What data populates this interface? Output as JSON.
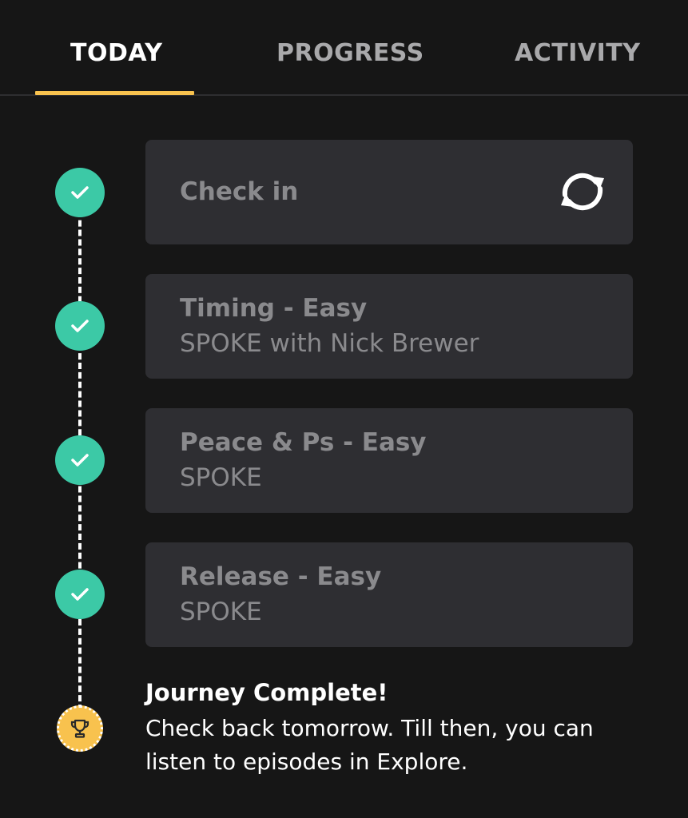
{
  "tabs": [
    {
      "label": "TODAY",
      "active": true
    },
    {
      "label": "PROGRESS",
      "active": false
    },
    {
      "label": "ACTIVITY",
      "active": false
    }
  ],
  "colors": {
    "background": "#161616",
    "accent": "#f8c24e",
    "check": "#3cc9a6",
    "card": "#2e2e32",
    "muted_text": "#8a8a8d"
  },
  "steps": [
    {
      "title": "Check in",
      "subtitle": "",
      "icon": "sync-icon",
      "completed": true
    },
    {
      "title": "Timing - Easy",
      "subtitle": "SPOKE with Nick Brewer",
      "completed": true
    },
    {
      "title": "Peace & Ps - Easy",
      "subtitle": "SPOKE",
      "completed": true
    },
    {
      "title": "Release - Easy",
      "subtitle": "SPOKE",
      "completed": true
    }
  ],
  "completion": {
    "icon": "trophy-icon",
    "title": "Journey Complete!",
    "message": "Check back tomorrow. Till then, you can listen to episodes in Explore."
  }
}
